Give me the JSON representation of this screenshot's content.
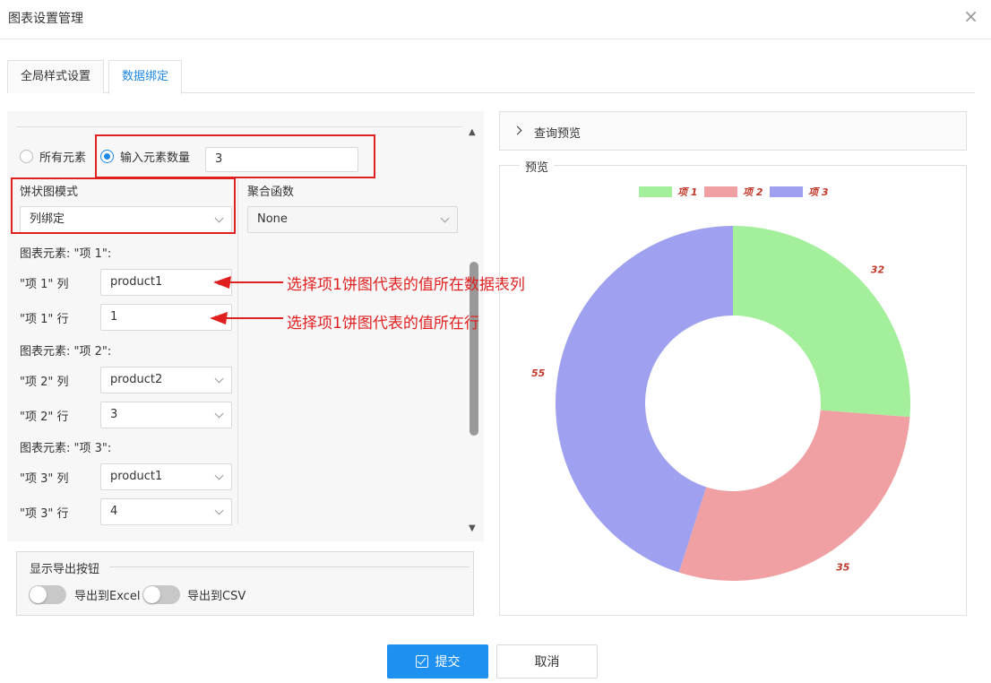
{
  "dialog": {
    "title": "图表设置管理",
    "close": "×"
  },
  "tabs": [
    {
      "label": "全局样式设置",
      "active": false
    },
    {
      "label": "数据绑定",
      "active": true
    }
  ],
  "mode": {
    "all_elements_label": "所有元素",
    "input_count_label": "输入元素数量",
    "count_value": "3",
    "selected": "input_count"
  },
  "pie_mode": {
    "label": "饼状图模式",
    "value": "列绑定"
  },
  "aggregate": {
    "label": "聚合函数",
    "value": "None"
  },
  "elements": [
    {
      "header": "图表元素: \"项 1\":",
      "col_label": "\"项 1\" 列",
      "col_value": "product1",
      "row_label": "\"项 1\" 行",
      "row_value": "1"
    },
    {
      "header": "图表元素: \"项 2\":",
      "col_label": "\"项 2\" 列",
      "col_value": "product2",
      "row_label": "\"项 2\" 行",
      "row_value": "3"
    },
    {
      "header": "图表元素: \"项 3\":",
      "col_label": "\"项 3\" 列",
      "col_value": "product1",
      "row_label": "\"项 3\" 行",
      "row_value": "4"
    }
  ],
  "annotations": {
    "col_note": "选择项1饼图代表的值所在数据表列",
    "row_note": "选择项1饼图代表的值所在行"
  },
  "export": {
    "title": "显示导出按钮",
    "excel_label": "导出到Excel",
    "csv_label": "导出到CSV"
  },
  "query_preview": {
    "label": "查询预览"
  },
  "preview": {
    "title": "预览"
  },
  "chart_data": {
    "type": "pie",
    "donut": true,
    "categories": [
      "项 1",
      "项 2",
      "项 3"
    ],
    "values": [
      32,
      35,
      55
    ],
    "colors": [
      "#a3ef9c",
      "#f0a0a2",
      "#a0a0f0"
    ],
    "legend": "top-center",
    "label_color": "#c0392b"
  },
  "buttons": {
    "submit": "提交",
    "cancel": "取消"
  },
  "colors": {
    "accent": "#1e88e5",
    "annotation": "#e02020"
  }
}
